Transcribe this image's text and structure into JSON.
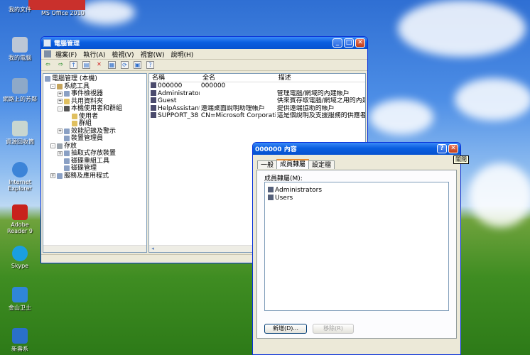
{
  "desktop": {
    "icons": [
      {
        "label": "我的文件"
      },
      {
        "label": "我的電腦"
      },
      {
        "label": "網路上的芳鄰"
      },
      {
        "label": "資源回收筒"
      },
      {
        "label": "Internet Explorer"
      },
      {
        "label": "Adobe Reader 9"
      },
      {
        "label": "Skype"
      },
      {
        "label": "金山卫士"
      },
      {
        "label": "新壽系"
      }
    ],
    "top_label": "MS Office 2010"
  },
  "main_window": {
    "title": "電腦管理",
    "menu": [
      "檔案(F)",
      "執行(A)",
      "檢視(V)",
      "視窗(W)",
      "說明(H)"
    ],
    "tree": [
      {
        "label": "電腦管理 (本機)",
        "level": 0,
        "expander": ""
      },
      {
        "label": "系統工具",
        "level": 1,
        "expander": "-"
      },
      {
        "label": "事件檢視器",
        "level": 2,
        "expander": "+"
      },
      {
        "label": "共用資料夾",
        "level": 2,
        "expander": "+"
      },
      {
        "label": "本機使用者和群組",
        "level": 2,
        "expander": "-"
      },
      {
        "label": "使用者",
        "level": 3,
        "expander": ""
      },
      {
        "label": "群組",
        "level": 3,
        "expander": ""
      },
      {
        "label": "效能記錄及警示",
        "level": 2,
        "expander": "+"
      },
      {
        "label": "裝置管理員",
        "level": 2,
        "expander": ""
      },
      {
        "label": "存放",
        "level": 1,
        "expander": "-"
      },
      {
        "label": "抽取式存放裝置",
        "level": 2,
        "expander": "+"
      },
      {
        "label": "磁碟重組工具",
        "level": 2,
        "expander": ""
      },
      {
        "label": "磁碟管理",
        "level": 2,
        "expander": ""
      },
      {
        "label": "服務及應用程式",
        "level": 1,
        "expander": "+"
      }
    ],
    "columns": [
      "名稱",
      "全名",
      "描述"
    ],
    "rows": [
      {
        "name": "000000",
        "full": "000000",
        "desc": ""
      },
      {
        "name": "Administrator",
        "full": "",
        "desc": "管理電腦/網域的內建帳戶"
      },
      {
        "name": "Guest",
        "full": "",
        "desc": "供來賓存取電腦/網域之用的內建"
      },
      {
        "name": "HelpAssistant",
        "full": "遠端桌面說明助理帳戶",
        "desc": "提供遠端協助的帳戶"
      },
      {
        "name": "SUPPORT_38",
        "full": "CN=Microsoft Corporation",
        "desc": "這是個說明及支援服務的供應者帳"
      }
    ]
  },
  "dialog": {
    "title": "000000 內容",
    "tooltip": "關閉",
    "tabs": [
      "一般",
      "成員隸屬",
      "設定檔"
    ],
    "active_tab": 1,
    "member_label": "成員隸屬(M):",
    "members": [
      "Administrators",
      "Users"
    ],
    "add_button": "新增(D)...",
    "remove_button": "移除(R)"
  }
}
